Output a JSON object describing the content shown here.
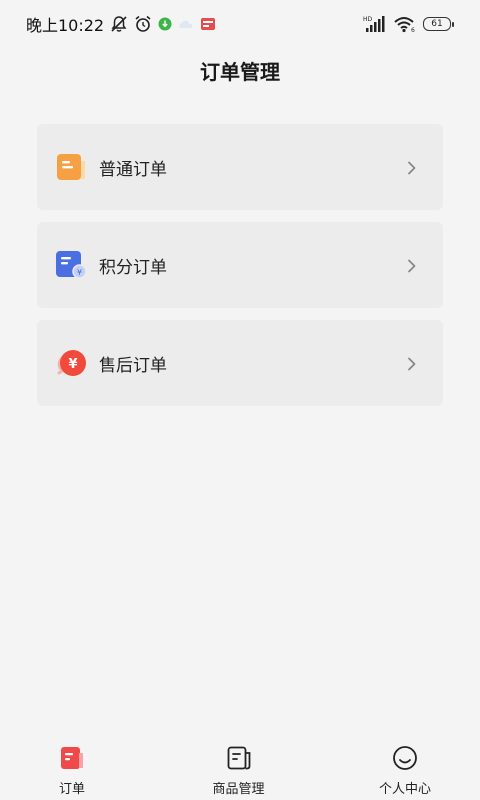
{
  "status_bar": {
    "time": "晚上10:22",
    "battery": "61",
    "network_label": "HD",
    "wifi_sub": "6"
  },
  "header": {
    "title": "订单管理"
  },
  "menu": {
    "items": [
      {
        "label": "普通订单",
        "icon": "normal-order-icon",
        "color": "#f5a042"
      },
      {
        "label": "积分订单",
        "icon": "points-order-icon",
        "color": "#4a6fe0"
      },
      {
        "label": "售后订单",
        "icon": "after-sales-order-icon",
        "color": "#ef4a3c"
      }
    ]
  },
  "bottom_nav": {
    "items": [
      {
        "label": "订单",
        "icon": "order-tab-icon",
        "active": true
      },
      {
        "label": "商品管理",
        "icon": "goods-tab-icon",
        "active": false
      },
      {
        "label": "个人中心",
        "icon": "profile-tab-icon",
        "active": false
      }
    ]
  },
  "colors": {
    "background": "#f4f4f4",
    "card": "#ececec",
    "accent": "#ef4a4a"
  }
}
